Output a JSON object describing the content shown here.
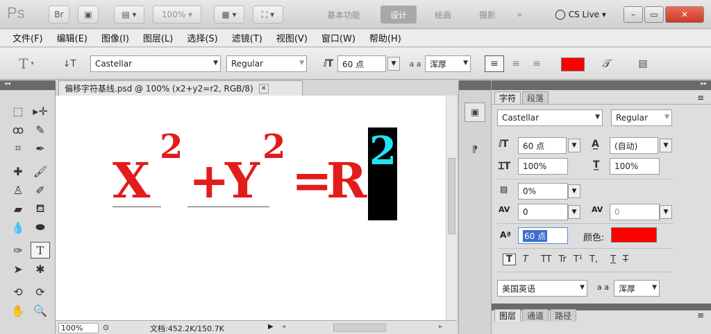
{
  "appbar": {
    "logo": "Ps",
    "zoom": "100%",
    "workspaces": [
      "基本功能",
      "设计",
      "绘画",
      "摄影"
    ],
    "more": "»",
    "cs_live": "CS Live",
    "win_controls": [
      "–",
      "▭",
      "✕"
    ]
  },
  "menu": [
    "文件(F)",
    "编辑(E)",
    "图像(I)",
    "图层(L)",
    "选择(S)",
    "滤镜(T)",
    "视图(V)",
    "窗口(W)",
    "帮助(H)"
  ],
  "options": {
    "tool_glyph": "T",
    "font_family": "Castellar",
    "font_style": "Regular",
    "font_size": "60 点",
    "antialias_label": "a a",
    "antialias": "浑厚",
    "color": "#ff0000"
  },
  "document": {
    "tab_title": "偏移字符基线.psd @ 100% (x2+y2=r2, RGB/8)",
    "close": "✕",
    "formula": {
      "x": "X",
      "x_exp": "2",
      "plus": "+",
      "y": "Y",
      "y_exp": "2",
      "eq": "=",
      "r": "R",
      "r_exp": "2"
    },
    "zoom": "100%",
    "doc_info": "文档:452.2K/150.7K"
  },
  "character_panel": {
    "tabs": [
      "字符",
      "段落"
    ],
    "font_family": "Castellar",
    "font_style": "Regular",
    "size": "60 点",
    "leading": "(自动)",
    "vscale": "100%",
    "hscale": "100%",
    "tsume": "0%",
    "kerning": "0",
    "tracking": "0",
    "baseline_shift": "60 点",
    "color_label": "颜色:",
    "color": "#ff0000",
    "language": "美国英语",
    "antialias_label": "a a",
    "antialias": "浑厚",
    "style_buttons": [
      "T",
      "T",
      "TT",
      "Tr",
      "T¹",
      "T,",
      "T",
      "T"
    ],
    "bottom_tabs": [
      "图层",
      "通道",
      "路径"
    ]
  }
}
